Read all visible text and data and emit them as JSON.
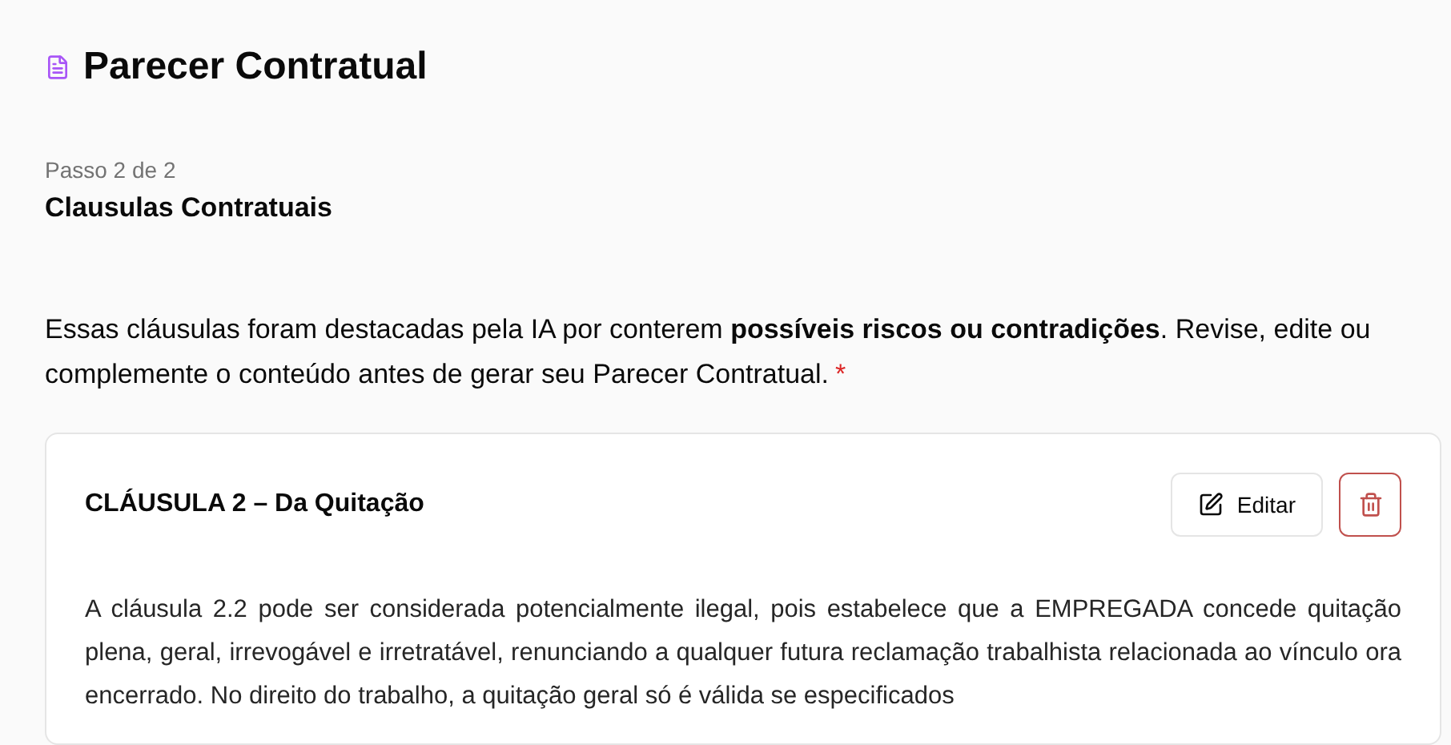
{
  "page": {
    "title": "Parecer Contratual"
  },
  "step": {
    "counter": "Passo 2 de 2",
    "title": "Clausulas Contratuais"
  },
  "intro": {
    "text": "Essas cláusulas foram destacadas pela IA por conterem **possíveis riscos ou contradições**. Revise, edite ou complemente o conteúdo antes de gerar seu Parecer Contratual.",
    "required_mark": "*"
  },
  "clauses": [
    {
      "title": "CLÁUSULA 2 – Da Quitação",
      "edit_label": "Editar",
      "body": "A cláusula 2.2 pode ser considerada potencialmente ilegal, pois estabelece que a EMPREGADA concede quitação plena, geral, irrevogável e irretratável, renunciando a qualquer futura reclamação trabalhista relacionada ao vínculo ora encerrado. No direito do trabalho, a quitação geral só é válida se especificados"
    }
  ]
}
